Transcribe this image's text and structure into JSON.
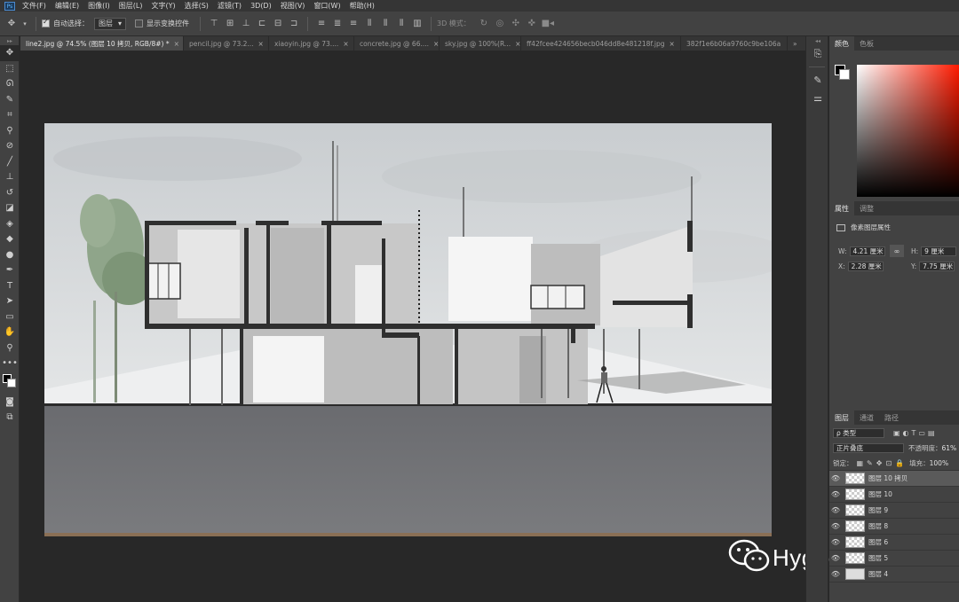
{
  "menu": {
    "app_icon": "Ps",
    "items": [
      "文件(F)",
      "编辑(E)",
      "图像(I)",
      "图层(L)",
      "文字(Y)",
      "选择(S)",
      "滤镜(T)",
      "3D(D)",
      "视图(V)",
      "窗口(W)",
      "帮助(H)"
    ]
  },
  "options": {
    "auto_select_label": "自动选择：",
    "auto_select_target": "图层",
    "transform_controls_label": "显示变换控件",
    "mode_3d_label": "3D 模式："
  },
  "tabs": [
    {
      "label": "line2.jpg @ 74.5% (图层 10 拷贝, RGB/8#) *",
      "active": true
    },
    {
      "label": "pencil.jpg @ 73.2...",
      "active": false
    },
    {
      "label": "xiaoyin.jpg @ 73....",
      "active": false
    },
    {
      "label": "concrete.jpg @ 66....",
      "active": false
    },
    {
      "label": "sky.jpg @ 100%(R...",
      "active": false
    },
    {
      "label": "ff42fcee424656becb046dd8e481218f.jpg",
      "active": false
    },
    {
      "label": "382f1e6b06a9760c9be106a",
      "active": false
    }
  ],
  "color_panel": {
    "tabs": [
      "颜色",
      "色板"
    ],
    "hue_color": "#ff1a00"
  },
  "properties_panel": {
    "tabs": [
      "属性",
      "调整"
    ],
    "title": "像素图层属性",
    "w_label": "W:",
    "w_value": "4.21 厘米",
    "h_label": "H:",
    "h_value": "9 厘米",
    "x_label": "X:",
    "x_value": "2.28 厘米",
    "y_label": "Y:",
    "y_value": "7.75 厘米"
  },
  "layers_panel": {
    "tabs": [
      "图层",
      "通道",
      "路径"
    ],
    "filter_label": "ρ 类型",
    "blend_mode": "正片叠底",
    "opacity_label": "不透明度：",
    "opacity_value": "61%",
    "lock_label": "锁定：",
    "fill_label": "填充：",
    "fill_value": "100%",
    "layers": [
      {
        "name": "图层 10 拷贝",
        "selected": true
      },
      {
        "name": "图层 10",
        "selected": false
      },
      {
        "name": "图层 9",
        "selected": false
      },
      {
        "name": "图层 8",
        "selected": false
      },
      {
        "name": "图层 6",
        "selected": false
      },
      {
        "name": "图层 5",
        "selected": false
      },
      {
        "name": "图层 4",
        "selected": false
      }
    ]
  },
  "watermark": {
    "text": "HyggeArt灰格",
    "icon": "wechat-icon"
  }
}
